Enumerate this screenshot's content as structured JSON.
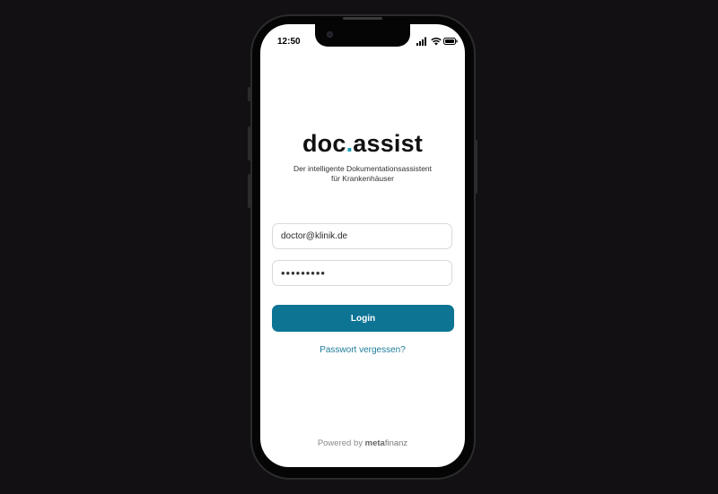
{
  "status_bar": {
    "time": "12:50",
    "icons": [
      "cellular-signal-icon",
      "wifi-icon",
      "battery-icon"
    ]
  },
  "app": {
    "logo_text_1": "doc",
    "logo_dot": ".",
    "logo_text_2": "assist",
    "tagline_line1": "Der intelligente Dokumentationsassistent",
    "tagline_line2": "für Krankenhäuser"
  },
  "login_form": {
    "email_value": "doctor@klinik.de",
    "password_value": "•••••••••",
    "login_label": "Login",
    "forgot_label": "Passwort vergessen?"
  },
  "footer": {
    "powered_by": "Powered by",
    "brand_bold": "meta",
    "brand_light": "finanz"
  },
  "colors": {
    "background": "#121013",
    "accent": "#0d7494",
    "logo_dot": "#1aa0b8",
    "link": "#1d7c98"
  }
}
